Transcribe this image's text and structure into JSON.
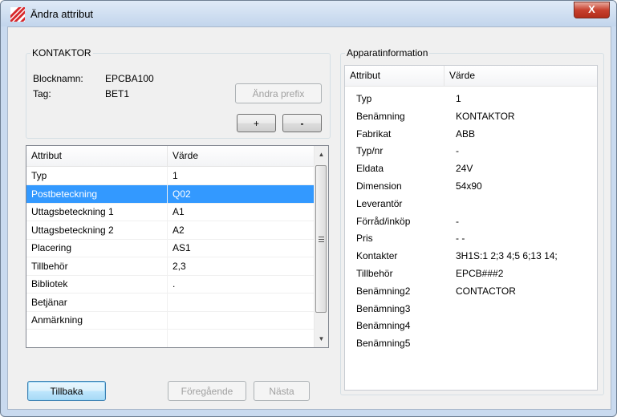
{
  "window": {
    "title": "Ändra attribut",
    "close_label": "X",
    "icon": "app-red-diagonal-icon"
  },
  "device": {
    "legend": "KONTAKTOR",
    "blockname_label": "Blocknamn:",
    "blockname_value": "EPCBA100",
    "tag_label": "Tag:",
    "tag_value": "BET1",
    "change_prefix_label": "Ändra prefix",
    "plus_label": "+",
    "minus_label": "-"
  },
  "attr_table": {
    "columns": [
      "Attribut",
      "Värde"
    ],
    "selected_index": 1,
    "rows": [
      {
        "attribute": "Typ",
        "value": "1"
      },
      {
        "attribute": "Postbeteckning",
        "value": "Q02"
      },
      {
        "attribute": "Uttagsbeteckning 1",
        "value": "A1"
      },
      {
        "attribute": "Uttagsbeteckning 2",
        "value": "A2"
      },
      {
        "attribute": "Placering",
        "value": "AS1"
      },
      {
        "attribute": "Tillbehör",
        "value": "2,3"
      },
      {
        "attribute": "Bibliotek",
        "value": "."
      },
      {
        "attribute": "Betjänar",
        "value": ""
      },
      {
        "attribute": "Anmärkning",
        "value": ""
      },
      {
        "attribute": "",
        "value": ""
      }
    ]
  },
  "apparat": {
    "legend": "Apparatinformation",
    "columns": [
      "Attribut",
      "Värde"
    ],
    "rows": [
      {
        "attribute": "Typ",
        "value": "1"
      },
      {
        "attribute": "Benämning",
        "value": "KONTAKTOR"
      },
      {
        "attribute": "Fabrikat",
        "value": "ABB"
      },
      {
        "attribute": "Typ/nr",
        "value": "-"
      },
      {
        "attribute": "Eldata",
        "value": "24V"
      },
      {
        "attribute": "Dimension",
        "value": "54x90"
      },
      {
        "attribute": "Leverantör",
        "value": ""
      },
      {
        "attribute": "Förråd/inköp",
        "value": "-"
      },
      {
        "attribute": "Pris",
        "value": "-   -"
      },
      {
        "attribute": "Kontakter",
        "value": "3H1S:1 2;3 4;5 6;13 14;"
      },
      {
        "attribute": "Tillbehör",
        "value": "EPCB###2"
      },
      {
        "attribute": "Benämning2",
        "value": "CONTACTOR"
      },
      {
        "attribute": "Benämning3",
        "value": ""
      },
      {
        "attribute": "Benämning4",
        "value": ""
      },
      {
        "attribute": "Benämning5",
        "value": ""
      }
    ]
  },
  "buttons": {
    "back": "Tillbaka",
    "previous": "Föregående",
    "next": "Nästa"
  },
  "colors": {
    "selection": "#3399ff",
    "close": "#c7402e"
  }
}
